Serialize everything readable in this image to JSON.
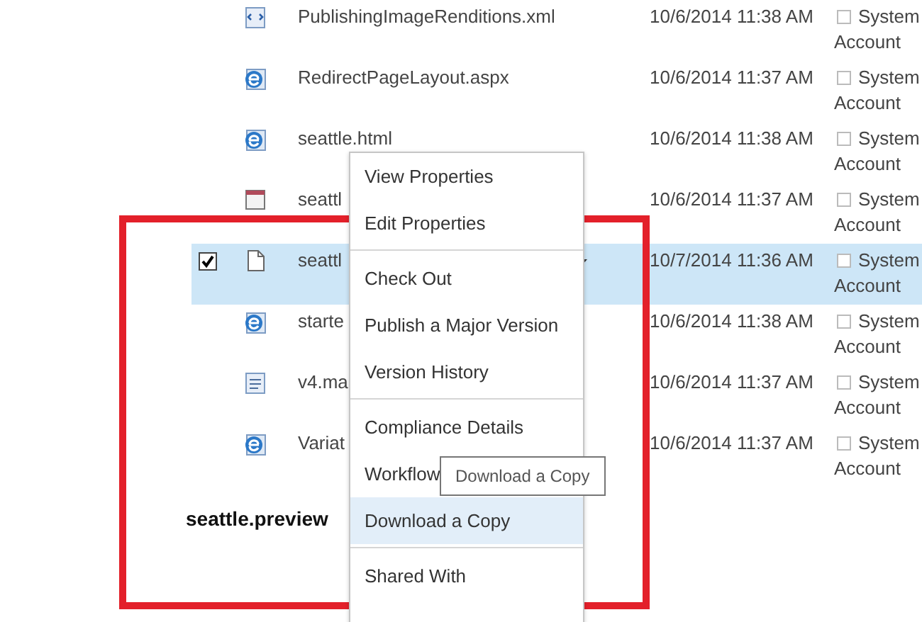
{
  "rows": [
    {
      "kind": "xml",
      "name": "PublishingImageRenditions.xml",
      "modified": "10/6/2014 11:38 AM",
      "user": "System",
      "user_line2": "Account",
      "selected": false
    },
    {
      "kind": "web",
      "name": "RedirectPageLayout.aspx",
      "modified": "10/6/2014 11:37 AM",
      "user": "System",
      "user_line2": "Account",
      "selected": false
    },
    {
      "kind": "web",
      "name": "seattle.html",
      "modified": "10/6/2014 11:38 AM",
      "user": "System",
      "user_line2": "Account",
      "selected": false
    },
    {
      "kind": "master",
      "name": "seattl",
      "modified": "10/6/2014 11:37 AM",
      "user": "System",
      "user_line2": "Account",
      "selected": false
    },
    {
      "kind": "blank",
      "name": "seattl",
      "modified": "10/7/2014 11:36 AM",
      "user": "System",
      "user_line2": "Account",
      "selected": true
    },
    {
      "kind": "web",
      "name": "starte",
      "modified": "10/6/2014 11:38 AM",
      "user": "System",
      "user_line2": "Account",
      "selected": false
    },
    {
      "kind": "doc",
      "name": "v4.ma",
      "modified": "10/6/2014 11:37 AM",
      "user": "System",
      "user_line2": "Account",
      "selected": false
    },
    {
      "kind": "web",
      "name": "Variat",
      "modified": "10/6/2014 11:37 AM",
      "user": "System",
      "user_line2": "Account",
      "selected": false
    }
  ],
  "preview_label": "seattle.preview",
  "menu": [
    {
      "kind": "item",
      "label": "View Properties",
      "highlighted": false
    },
    {
      "kind": "item",
      "label": "Edit Properties",
      "highlighted": false
    },
    {
      "kind": "divider"
    },
    {
      "kind": "item",
      "label": "Check Out",
      "highlighted": false
    },
    {
      "kind": "item",
      "label": "Publish a Major Version",
      "highlighted": false
    },
    {
      "kind": "item",
      "label": "Version History",
      "highlighted": false
    },
    {
      "kind": "divider"
    },
    {
      "kind": "item",
      "label": "Compliance Details",
      "highlighted": false
    },
    {
      "kind": "item",
      "label": "Workflow",
      "highlighted": false
    },
    {
      "kind": "item",
      "label": "Download a Copy",
      "highlighted": true
    },
    {
      "kind": "divider"
    },
    {
      "kind": "item",
      "label": "Shared With",
      "highlighted": false
    }
  ],
  "tooltip": "Download a Copy"
}
